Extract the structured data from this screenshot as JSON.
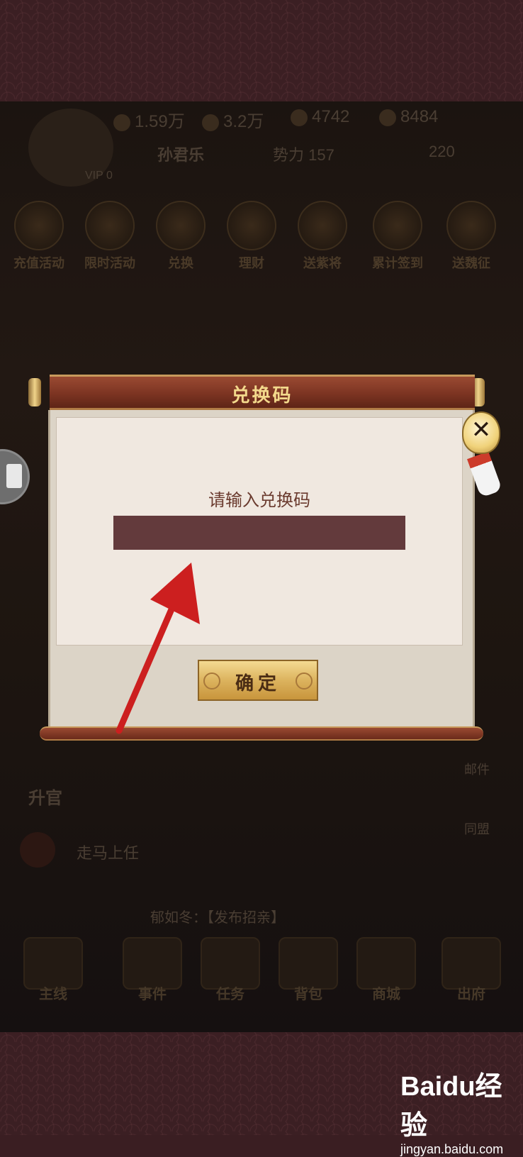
{
  "background": {
    "resources": [
      "1.59万",
      "3.2万",
      "4742",
      "8484"
    ],
    "player_name": "孙君乐",
    "power_label": "势力",
    "power_value": "157",
    "ingots": "220",
    "vip_label": "VIP 0",
    "features": [
      "充值活动",
      "限时活动",
      "兑换",
      "理财",
      "送紫将",
      "累计签到",
      "送魏征"
    ],
    "quest_text": "走马上任",
    "chat_message": "郁如冬：【发布招亲】",
    "side_labels": [
      "升官",
      "邮件",
      "同盟"
    ],
    "bottom_nav": [
      "主线",
      "事件",
      "任务",
      "背包",
      "商城",
      "出府"
    ]
  },
  "dialog": {
    "title": "兑换码",
    "prompt": "请输入兑换码",
    "input_value": "",
    "confirm_label": "确定",
    "close_icon": "close-icon"
  },
  "watermark": {
    "brand": "Baidu经验",
    "site": "jingyan.baidu.com"
  },
  "colors": {
    "dialog_header": "#7c3422",
    "input_bg": "#633a3c",
    "arrow": "#cc1f1f",
    "confirm_gold": "#dcb35e"
  }
}
